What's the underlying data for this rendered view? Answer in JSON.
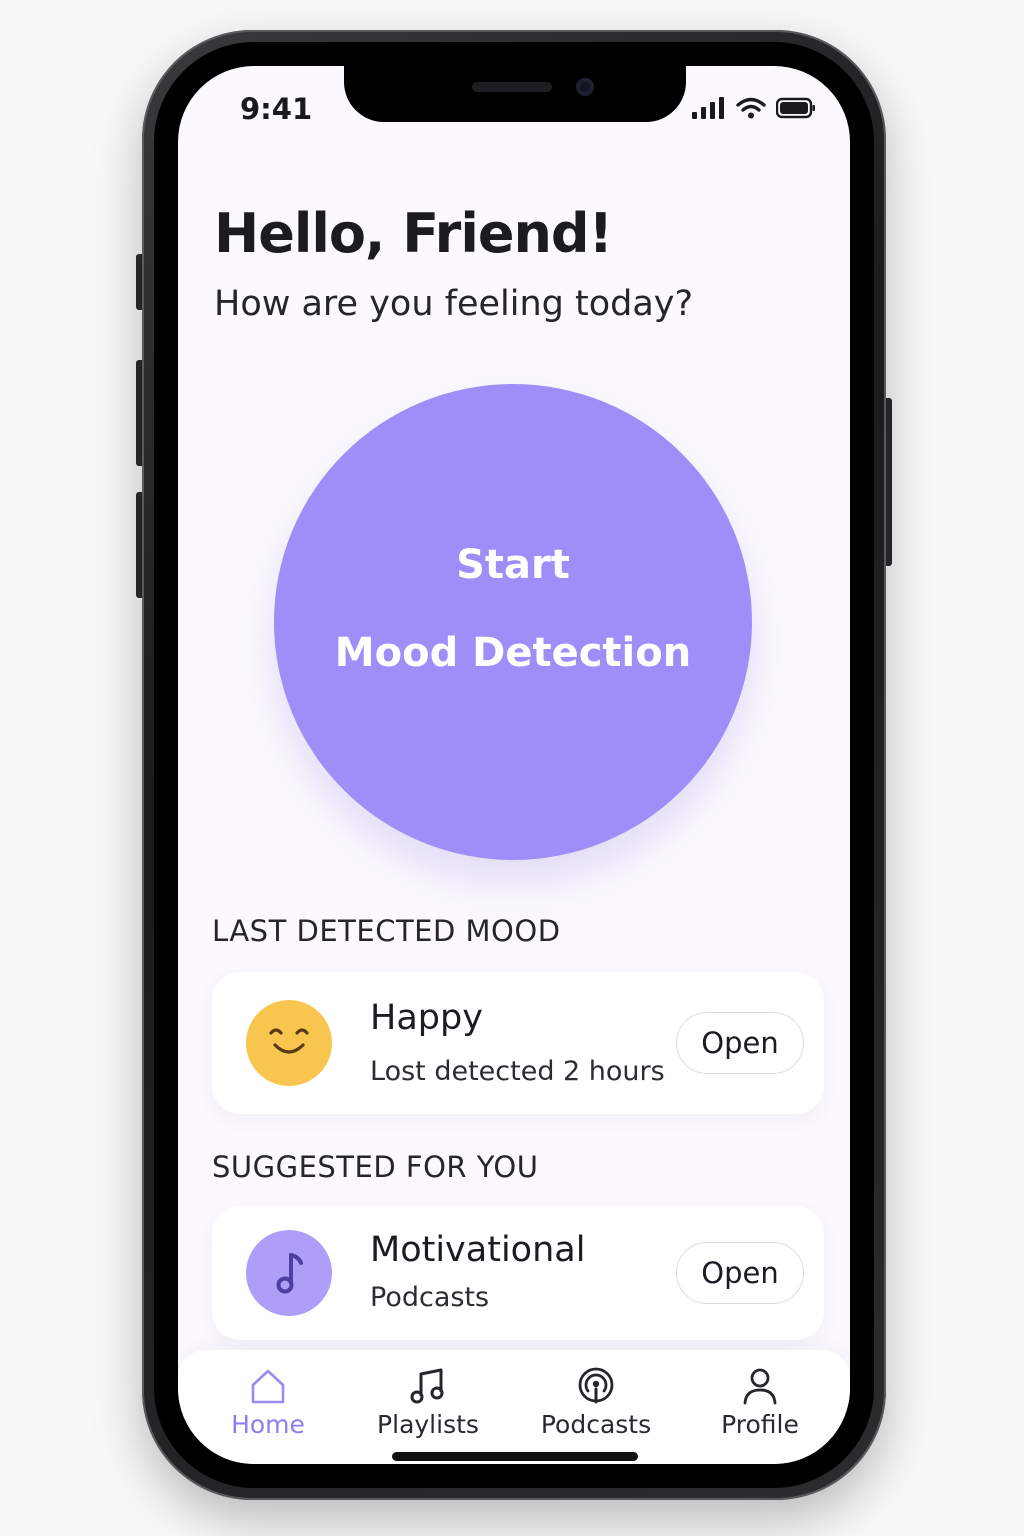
{
  "status_bar": {
    "time": "9:41"
  },
  "header": {
    "greeting": "Hello, Friend!",
    "subtitle": "How are you feeling today?"
  },
  "mood_button": {
    "line1": "Start",
    "line2": "Mood Detection"
  },
  "last_mood": {
    "section_label": "LAST DETECTED MOOD",
    "title": "Happy",
    "subtitle": "Lost detected 2 hours",
    "open_label": "Open",
    "icon": "smiley-face-icon"
  },
  "suggested": {
    "section_label": "SUGGESTED FOR YOU",
    "title": "Motivational",
    "subtitle": "Podcasts",
    "open_label": "Open",
    "icon": "music-note-icon"
  },
  "tabs": [
    {
      "label": "Home",
      "icon": "home-icon",
      "active": true
    },
    {
      "label": "Playlists",
      "icon": "music-note-icon",
      "active": false
    },
    {
      "label": "Podcasts",
      "icon": "podcast-icon",
      "active": false
    },
    {
      "label": "Profile",
      "icon": "person-icon",
      "active": false
    }
  ],
  "colors": {
    "accent": "#a08ef8",
    "active_tab": "#8f7ef0",
    "happy_icon": "#f8c64e",
    "background": "#fbf9fe"
  }
}
